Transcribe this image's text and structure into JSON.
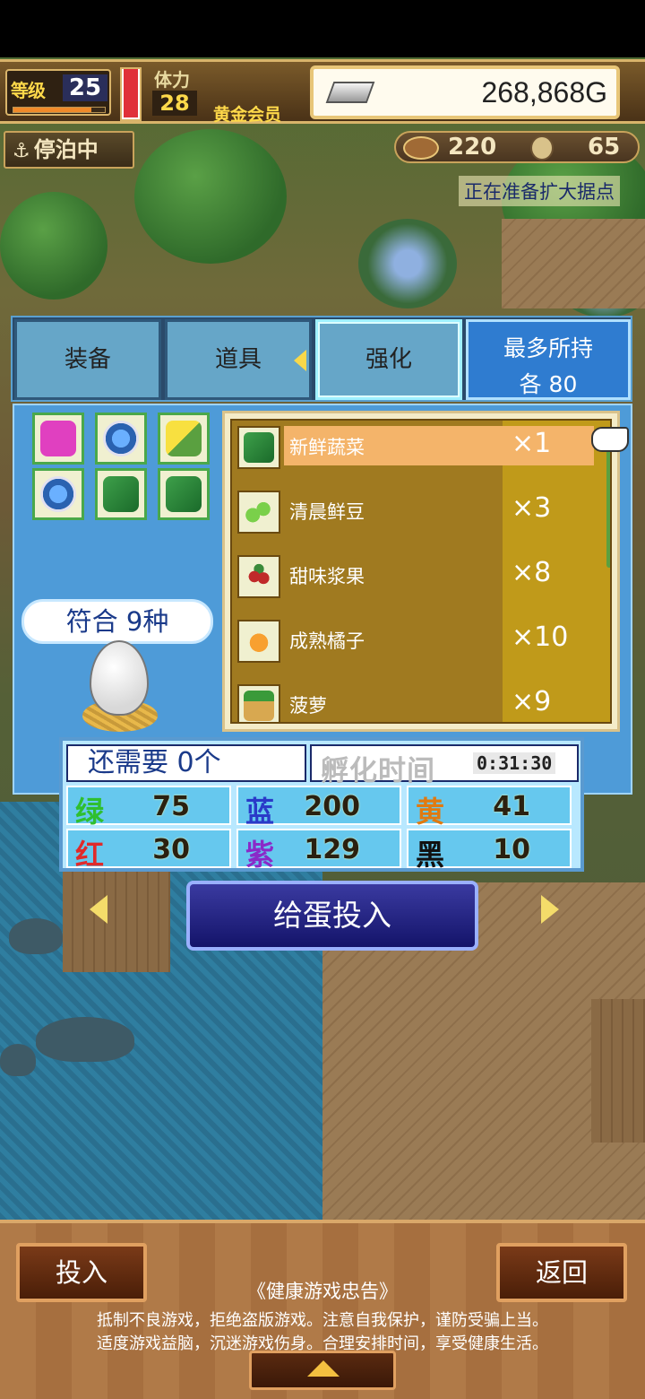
{
  "hud": {
    "level_label": "等级",
    "level_value": "25",
    "exp_progress": 0.85,
    "stamina_label": "体力",
    "stamina_value": "28",
    "stamina_level": 1.0,
    "member_badge": "黄金会员",
    "gold": "268,868G",
    "gold_icon": "silver-bar-icon",
    "anchor_status": "停泊中",
    "anchor_icon": "anchor-icon",
    "resource1_icon": "meat-icon",
    "resource1_value": "220",
    "resource2_icon": "coin-icon",
    "resource2_value": "65",
    "status_note": "正在准备扩大据点"
  },
  "tabs": [
    {
      "label": "装备"
    },
    {
      "label": "道具"
    },
    {
      "label": "强化"
    }
  ],
  "max_hold": {
    "title": "最多所持",
    "count": "各 80"
  },
  "slots": [
    {
      "icon": "ribbon-icon"
    },
    {
      "icon": "blue-egg-icon"
    },
    {
      "icon": "corn-icon"
    },
    {
      "icon": "blue-egg-icon"
    },
    {
      "icon": "glove-icon"
    },
    {
      "icon": "glove-icon"
    }
  ],
  "match": {
    "label": "符合 9种"
  },
  "items": [
    {
      "name": "新鲜蔬菜",
      "qty": "×1",
      "icon": "vegetable-icon"
    },
    {
      "name": "清晨鲜豆",
      "qty": "×3",
      "icon": "peas-icon"
    },
    {
      "name": "甜味浆果",
      "qty": "×8",
      "icon": "berry-icon"
    },
    {
      "name": "成熟橘子",
      "qty": "×10",
      "icon": "orange-icon"
    },
    {
      "name": "菠萝",
      "qty": "×9",
      "icon": "pineapple-icon"
    }
  ],
  "selected_item_index": 0,
  "needs": {
    "label": "还需要 0个"
  },
  "hatch": {
    "label": "孵化时间",
    "time": "0:31:30"
  },
  "stats": [
    {
      "name": "绿",
      "value": "75",
      "color": "#2fbf2f"
    },
    {
      "name": "蓝",
      "value": "200",
      "color": "#2a3ac8"
    },
    {
      "name": "黄",
      "value": "41",
      "color": "#e07a10"
    },
    {
      "name": "红",
      "value": "30",
      "color": "#e02a2a"
    },
    {
      "name": "紫",
      "value": "129",
      "color": "#8a2ac8"
    },
    {
      "name": "黑",
      "value": "10",
      "color": "#111111"
    }
  ],
  "feed_button": {
    "label": "给蛋投入"
  },
  "bottom": {
    "invest_label": "投入",
    "back_label": "返回",
    "advisory_title": "《健康游戏忠告》",
    "advisory_line1": "抵制不良游戏，拒绝盗版游戏。注意自我保护，谨防受骗上当。",
    "advisory_line2": "适度游戏益脑，沉迷游戏伤身。合理安排时间，享受健康生活。"
  }
}
